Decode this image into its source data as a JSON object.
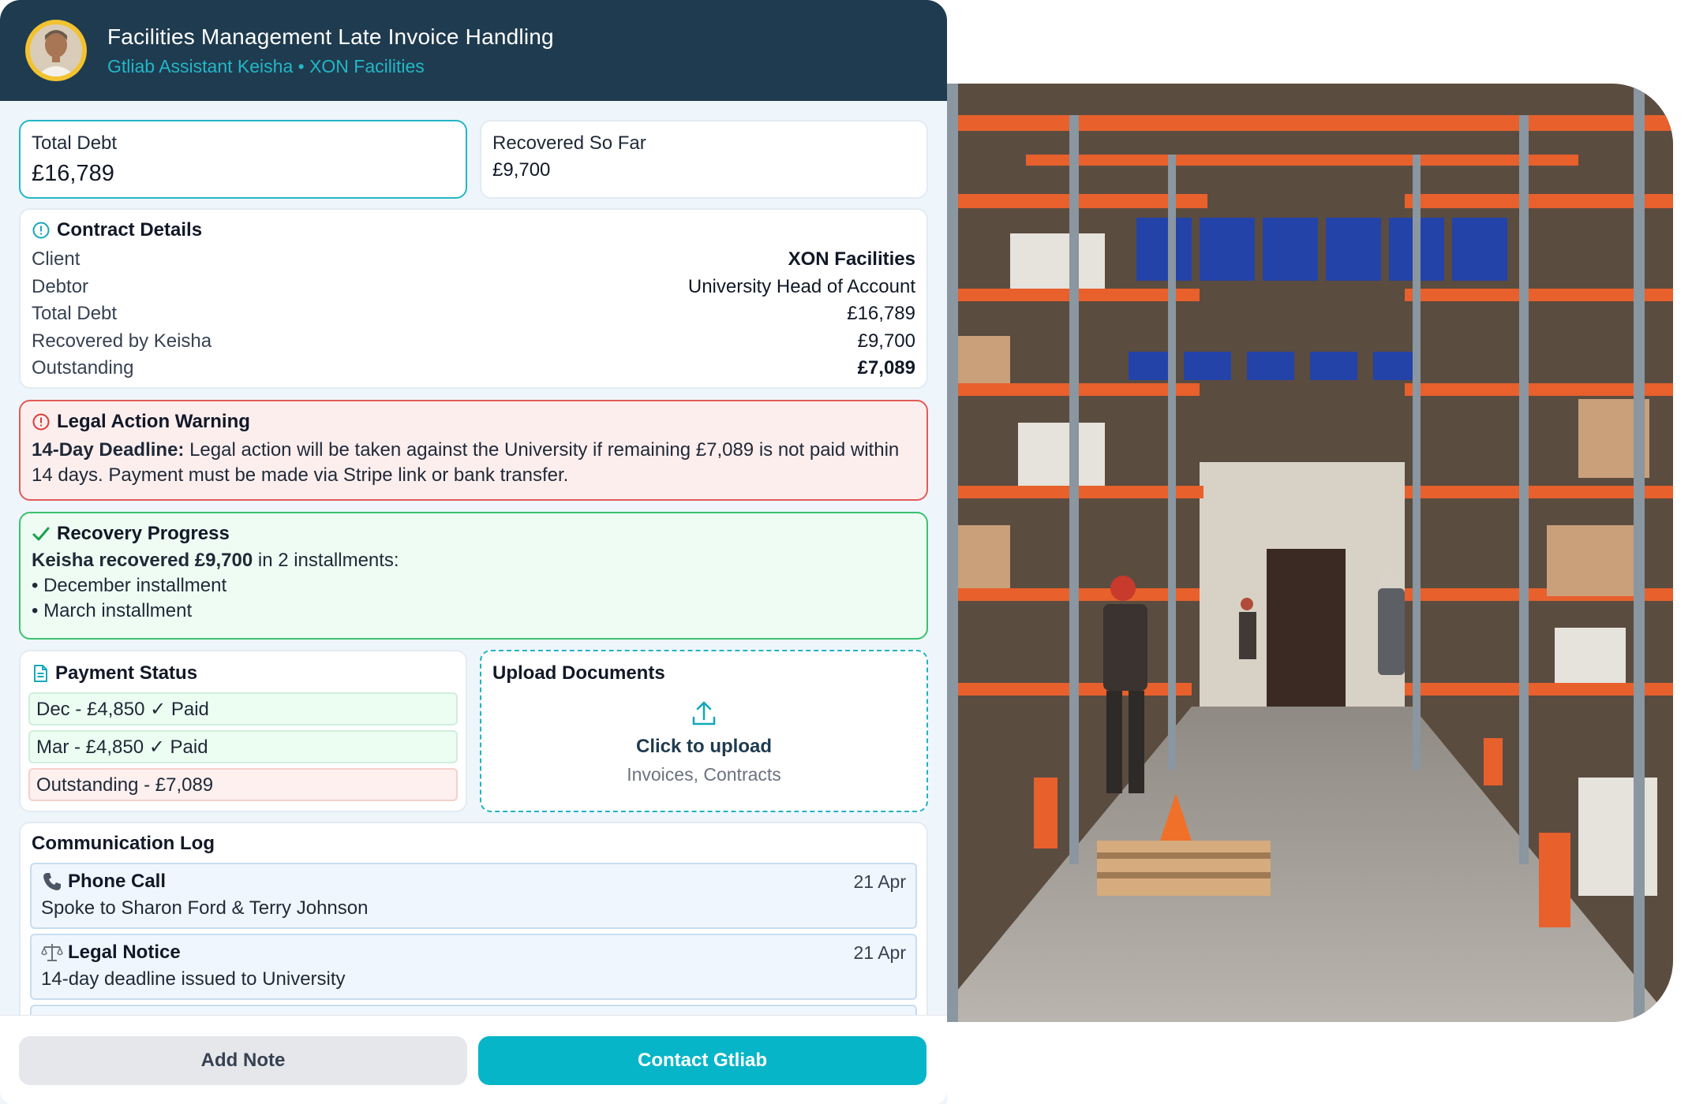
{
  "header": {
    "title": "Facilities Management Late Invoice Handling",
    "subtitle": "Gtliab Assistant Keisha • XON Facilities"
  },
  "stats": {
    "total_debt_label": "Total Debt",
    "total_debt_value": "£16,789",
    "recovered_label": "Recovered So Far",
    "recovered_value": "£9,700"
  },
  "contract": {
    "title": "Contract Details",
    "rows": [
      {
        "label": "Client",
        "value": "XON Facilities"
      },
      {
        "label": "Debtor",
        "value": "University Head of Account"
      },
      {
        "label": "Total Debt",
        "value": "£16,789"
      },
      {
        "label": "Recovered by Keisha",
        "value": "£9,700"
      },
      {
        "label": "Outstanding",
        "value": "£7,089"
      }
    ]
  },
  "warning": {
    "title": "Legal Action Warning",
    "lead": "14-Day Deadline:",
    "body": " Legal action will be taken against the University if remaining £7,089 is not paid within 14 days. Payment must be made via Stripe link or bank transfer."
  },
  "recovery": {
    "title": "Recovery Progress",
    "lead": "Keisha recovered £9,700",
    "lead_rest": " in 2 installments:",
    "items": [
      "• December installment",
      "• March installment"
    ]
  },
  "payment": {
    "title": "Payment Status",
    "items": [
      "Dec - £4,850 ✓ Paid",
      "Mar - £4,850 ✓ Paid",
      "Outstanding - £7,089"
    ]
  },
  "upload": {
    "title": "Upload Documents",
    "cta": "Click to upload",
    "hint": "Invoices, Contracts"
  },
  "log": {
    "title": "Communication Log",
    "items": [
      {
        "title": "Phone Call",
        "date": "21 Apr",
        "desc": "Spoke to Sharon Ford & Terry Johnson"
      },
      {
        "title": "Legal Notice",
        "date": "21 Apr",
        "desc": "14-day deadline issued to University"
      }
    ]
  },
  "footer": {
    "note_label": "Add Note",
    "contact_label": "Contact Gtliab"
  },
  "colors": {
    "header_bg": "#1f3b4f",
    "accent": "#06b6c8",
    "danger": "#dc3a36",
    "success": "#16a34a"
  }
}
